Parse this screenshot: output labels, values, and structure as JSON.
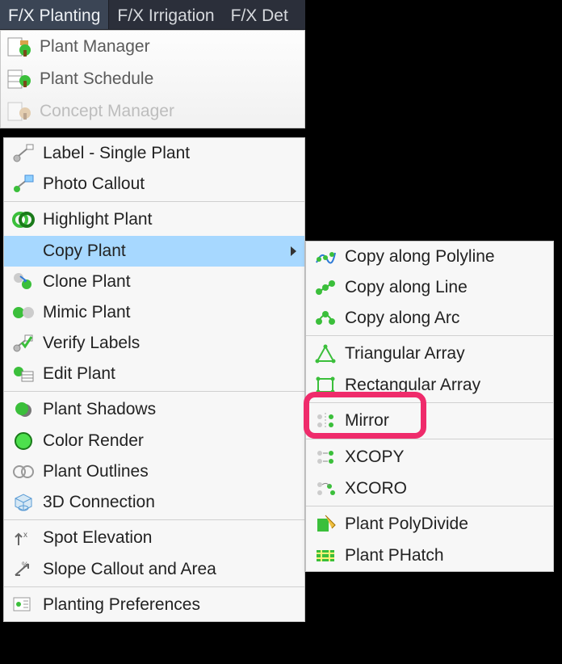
{
  "menubar": {
    "tabs": [
      "F/X Planting",
      "F/X Irrigation",
      "F/X Det"
    ],
    "active_index": 0
  },
  "ribbon": {
    "items": [
      {
        "label": "Plant Manager",
        "icon": "plant-manager-icon"
      },
      {
        "label": "Plant Schedule",
        "icon": "plant-schedule-icon"
      },
      {
        "label": "Concept Manager",
        "icon": "concept-manager-icon"
      }
    ]
  },
  "main_menu": {
    "highlight_index": 2,
    "items": [
      {
        "label": "Label - Single Plant",
        "icon": "label-single-plant-icon",
        "sep_before": false,
        "has_sub": false
      },
      {
        "label": "Photo Callout",
        "icon": "photo-callout-icon",
        "sep_before": false,
        "has_sub": false
      },
      {
        "label": "Highlight Plant",
        "icon": "highlight-plant-icon",
        "sep_before": true,
        "has_sub": false
      },
      {
        "label": "Copy Plant",
        "icon": "copy-plant-icon",
        "sep_before": false,
        "has_sub": true
      },
      {
        "label": "Clone Plant",
        "icon": "clone-plant-icon",
        "sep_before": false,
        "has_sub": false
      },
      {
        "label": "Mimic Plant",
        "icon": "mimic-plant-icon",
        "sep_before": false,
        "has_sub": false
      },
      {
        "label": "Verify Labels",
        "icon": "verify-labels-icon",
        "sep_before": false,
        "has_sub": false
      },
      {
        "label": "Edit Plant",
        "icon": "edit-plant-icon",
        "sep_before": false,
        "has_sub": false
      },
      {
        "label": "Plant Shadows",
        "icon": "plant-shadows-icon",
        "sep_before": true,
        "has_sub": false
      },
      {
        "label": "Color Render",
        "icon": "color-render-icon",
        "sep_before": false,
        "has_sub": false
      },
      {
        "label": "Plant Outlines",
        "icon": "plant-outlines-icon",
        "sep_before": false,
        "has_sub": false
      },
      {
        "label": "3D Connection",
        "icon": "three-d-connection-icon",
        "sep_before": false,
        "has_sub": false
      },
      {
        "label": "Spot Elevation",
        "icon": "spot-elevation-icon",
        "sep_before": true,
        "has_sub": false
      },
      {
        "label": "Slope Callout and Area",
        "icon": "slope-callout-icon",
        "sep_before": false,
        "has_sub": false
      },
      {
        "label": "Planting Preferences",
        "icon": "planting-preferences-icon",
        "sep_before": true,
        "has_sub": false
      }
    ]
  },
  "sub_menu": {
    "items": [
      {
        "label": "Copy along Polyline",
        "icon": "copy-polyline-icon",
        "sep_before": false
      },
      {
        "label": "Copy along Line",
        "icon": "copy-line-icon",
        "sep_before": false
      },
      {
        "label": "Copy along Arc",
        "icon": "copy-arc-icon",
        "sep_before": false
      },
      {
        "label": "Triangular Array",
        "icon": "triangular-array-icon",
        "sep_before": true
      },
      {
        "label": "Rectangular Array",
        "icon": "rectangular-array-icon",
        "sep_before": false
      },
      {
        "label": "Mirror",
        "icon": "mirror-icon",
        "sep_before": true
      },
      {
        "label": "XCOPY",
        "icon": "xcopy-icon",
        "sep_before": true
      },
      {
        "label": "XCORO",
        "icon": "xcoro-icon",
        "sep_before": false
      },
      {
        "label": "Plant PolyDivide",
        "icon": "plant-polydivide-icon",
        "sep_before": true
      },
      {
        "label": "Plant PHatch",
        "icon": "plant-phatch-icon",
        "sep_before": false
      }
    ],
    "callout_index": 5
  },
  "colors": {
    "highlight": "#a7d8ff",
    "callout": "#ef2b6b",
    "plant_green": "#3bbf3b"
  }
}
